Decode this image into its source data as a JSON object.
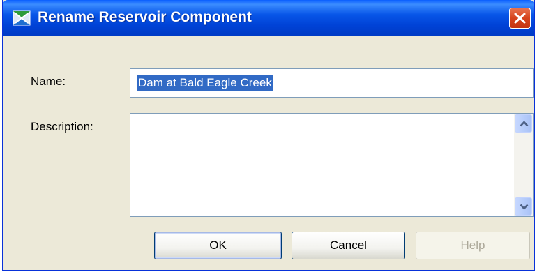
{
  "window": {
    "title": "Rename Reservoir Component",
    "title_bar_color": "#0054e3",
    "close_button_color": "#d6431c"
  },
  "form": {
    "name_label": "Name:",
    "name_value": "Dam at Bald Eagle Creek",
    "name_text_selected": true,
    "selection_color": "#316ac5",
    "description_label": "Description:",
    "description_value": ""
  },
  "icons": {
    "app": "reservoir-app-icon",
    "close": "close-icon",
    "scroll_up": "chevron-up-icon",
    "scroll_down": "chevron-down-icon"
  },
  "buttons": {
    "ok_label": "OK",
    "cancel_label": "Cancel",
    "help_label": "Help",
    "help_enabled": false
  }
}
